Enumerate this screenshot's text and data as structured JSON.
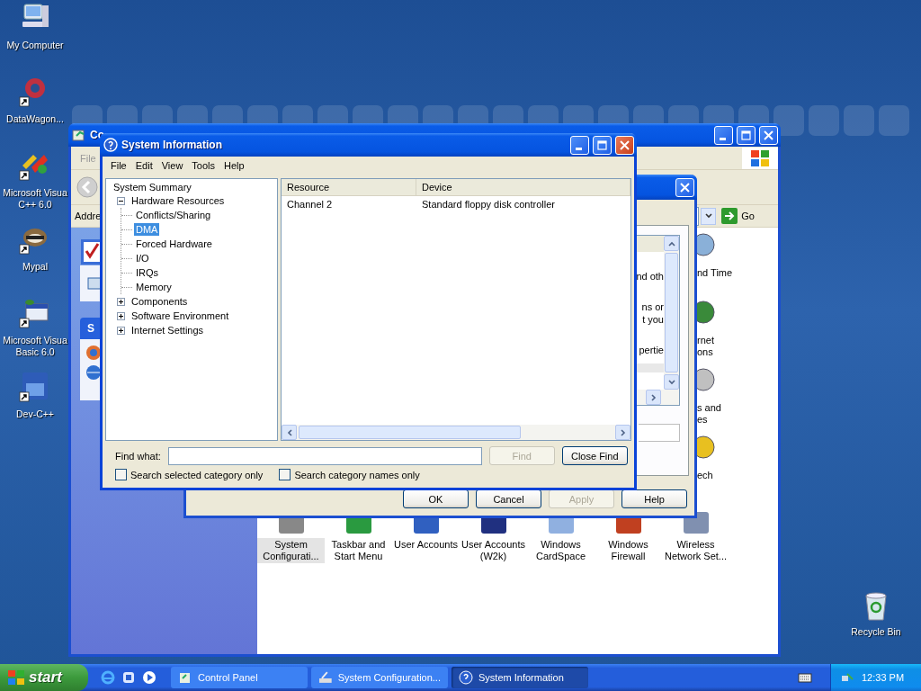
{
  "desktop_icons": [
    {
      "label": "My Computer",
      "shortcut": false
    },
    {
      "label": "DataWagon...",
      "shortcut": true
    },
    {
      "label": "Microsoft Visua C++ 6.0",
      "shortcut": true
    },
    {
      "label": "Mypal",
      "shortcut": true
    },
    {
      "label": "Microsoft Visua Basic 6.0",
      "shortcut": true
    },
    {
      "label": "Dev-C++",
      "shortcut": true
    }
  ],
  "recycle_bin": {
    "label": "Recycle Bin"
  },
  "control_panel": {
    "title": "Co",
    "menu": [
      "File"
    ],
    "address_label": "Addre",
    "go": "Go",
    "task_header": "S",
    "fragments": [
      {
        "lines": [
          "nd Time"
        ]
      },
      {
        "lines": [
          "rnet",
          "ons"
        ]
      },
      {
        "lines": [
          "s and",
          "es"
        ]
      },
      {
        "lines": [
          "ech"
        ]
      }
    ],
    "items": [
      {
        "label": "System Configurati...",
        "selected": true
      },
      {
        "label": "Taskbar and Start Menu",
        "selected": false
      },
      {
        "label": "User Accounts",
        "selected": false
      },
      {
        "label": "User Accounts (W2k)",
        "selected": false
      },
      {
        "label": "Windows CardSpace",
        "selected": false
      },
      {
        "label": "Windows Firewall",
        "selected": false
      },
      {
        "label": "Wireless Network Set...",
        "selected": false
      }
    ]
  },
  "system_configuration": {
    "list_groups": [
      {
        "lines": [
          "nd oth"
        ]
      },
      {
        "lines": [
          "ns or",
          "t you"
        ]
      },
      {
        "lines": [
          "pertie"
        ]
      }
    ],
    "buttons": [
      {
        "label": "OK",
        "disabled": false
      },
      {
        "label": "Cancel",
        "disabled": false
      },
      {
        "label": "Apply",
        "disabled": true
      },
      {
        "label": "Help",
        "disabled": false
      }
    ]
  },
  "system_information": {
    "title": "System Information",
    "menu": [
      "File",
      "Edit",
      "View",
      "Tools",
      "Help"
    ],
    "tree": [
      {
        "label": "System Summary",
        "selected": false,
        "children": [
          {
            "label": "Hardware Resources",
            "selected": false,
            "expanded": true,
            "children": [
              {
                "label": "Conflicts/Sharing",
                "selected": false
              },
              {
                "label": "DMA",
                "selected": true
              },
              {
                "label": "Forced Hardware",
                "selected": false
              },
              {
                "label": "I/O",
                "selected": false
              },
              {
                "label": "IRQs",
                "selected": false
              },
              {
                "label": "Memory",
                "selected": false
              }
            ]
          },
          {
            "label": "Components",
            "selected": false,
            "expanded": false
          },
          {
            "label": "Software Environment",
            "selected": false,
            "expanded": false
          },
          {
            "label": "Internet Settings",
            "selected": false,
            "expanded": false
          }
        ]
      }
    ],
    "columns": [
      "Resource",
      "Device"
    ],
    "rows": [
      [
        "Channel 2",
        "Standard floppy disk controller"
      ]
    ],
    "find_label": "Find what:",
    "find_button": {
      "label": "Find",
      "disabled": true
    },
    "close_find_button": {
      "label": "Close Find",
      "disabled": false
    },
    "options": [
      {
        "label": "Search selected category only",
        "checked": false
      },
      {
        "label": "Search category names only",
        "checked": false
      }
    ]
  },
  "taskbar": {
    "start": "start",
    "tasks": [
      {
        "label": "Control Panel",
        "selected": false
      },
      {
        "label": "System Configuration...",
        "selected": false
      },
      {
        "label": "System Information",
        "selected": true
      }
    ],
    "clock": "12:33 PM"
  }
}
